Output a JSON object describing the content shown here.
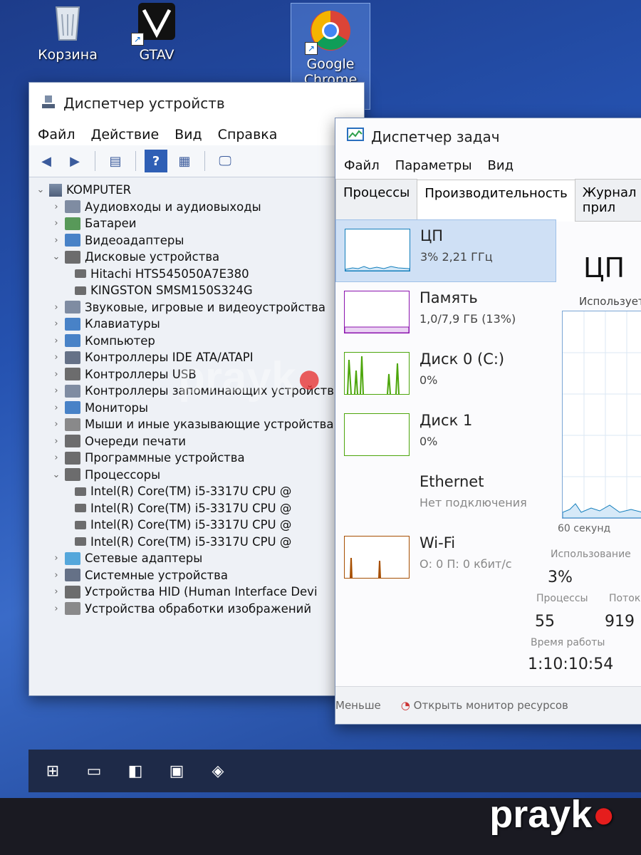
{
  "desktop": {
    "icons": [
      {
        "label": "Корзина"
      },
      {
        "label": "GTAV"
      },
      {
        "label": "Google Chrome"
      }
    ]
  },
  "device_manager": {
    "title": "Диспетчер устройств",
    "menu": [
      "Файл",
      "Действие",
      "Вид",
      "Справка"
    ],
    "root": "KOMPUTER",
    "tree": [
      {
        "label": "Аудиовходы и аудиовыходы",
        "expanded": false
      },
      {
        "label": "Батареи",
        "expanded": false
      },
      {
        "label": "Видеоадаптеры",
        "expanded": false
      },
      {
        "label": "Дисковые устройства",
        "expanded": true
      },
      {
        "label": "Hitachi HTS545050A7E380",
        "child": true
      },
      {
        "label": "KINGSTON SMSM150S324G",
        "child": true
      },
      {
        "label": "Звуковые, игровые и видеоустройства",
        "expanded": false
      },
      {
        "label": "Клавиатуры",
        "expanded": false
      },
      {
        "label": "Компьютер",
        "expanded": false
      },
      {
        "label": "Контроллеры IDE ATA/ATAPI",
        "expanded": false
      },
      {
        "label": "Контроллеры USB",
        "expanded": false
      },
      {
        "label": "Контроллеры запоминающих устройств",
        "expanded": false
      },
      {
        "label": "Мониторы",
        "expanded": false
      },
      {
        "label": "Мыши и иные указывающие устройства",
        "expanded": false
      },
      {
        "label": "Очереди печати",
        "expanded": false
      },
      {
        "label": "Программные устройства",
        "expanded": false
      },
      {
        "label": "Процессоры",
        "expanded": true
      },
      {
        "label": "Intel(R) Core(TM) i5-3317U CPU @",
        "child": true
      },
      {
        "label": "Intel(R) Core(TM) i5-3317U CPU @",
        "child": true
      },
      {
        "label": "Intel(R) Core(TM) i5-3317U CPU @",
        "child": true
      },
      {
        "label": "Intel(R) Core(TM) i5-3317U CPU @",
        "child": true
      },
      {
        "label": "Сетевые адаптеры",
        "expanded": false
      },
      {
        "label": "Системные устройства",
        "expanded": false
      },
      {
        "label": "Устройства HID (Human Interface Devi",
        "expanded": false
      },
      {
        "label": "Устройства обработки изображений",
        "expanded": false
      }
    ]
  },
  "task_manager": {
    "title": "Диспетчер задач",
    "menu": [
      "Файл",
      "Параметры",
      "Вид"
    ],
    "tabs": [
      "Процессы",
      "Производительность",
      "Журнал прил"
    ],
    "active_tab": 1,
    "perf_items": [
      {
        "name": "ЦП",
        "sub": "3% 2,21 ГГц",
        "color": "#117dbb"
      },
      {
        "name": "Память",
        "sub": "1,0/7,9 ГБ (13%)",
        "color": "#8b12ae"
      },
      {
        "name": "Диск 0 (C:)",
        "sub": "0%",
        "color": "#4da60c"
      },
      {
        "name": "Диск 1",
        "sub": "0%",
        "color": "#4da60c"
      },
      {
        "name": "Ethernet",
        "sub": "Нет подключения",
        "color": "#a74f01"
      },
      {
        "name": "Wi-Fi",
        "sub": "О: 0 П: 0 кбит/с",
        "color": "#a74f01"
      }
    ],
    "detail": {
      "title": "ЦП",
      "usage_label": "Использует",
      "seconds_label": "60 секунд",
      "usage_caption": "Использование",
      "usage_value": "3%",
      "processes_caption": "Процессы",
      "processes_value": "55",
      "threads_caption": "Поток",
      "threads_value": "919",
      "uptime_caption": "Время работы",
      "uptime_value": "1:10:10:54"
    },
    "footer": {
      "less": "Меньше",
      "resmon": "Открыть монитор ресурсов"
    }
  },
  "watermark": {
    "text": "prayk"
  }
}
